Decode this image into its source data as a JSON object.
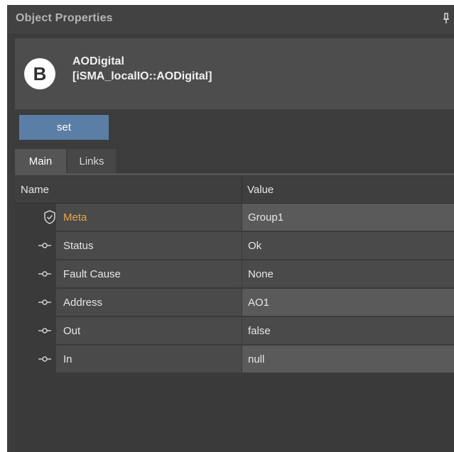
{
  "panel": {
    "title": "Object Properties",
    "colors": {
      "background": "#3c3c3c",
      "button": "#5b7ea6",
      "meta_label": "#e8a64a"
    }
  },
  "object": {
    "badge_letter": "B",
    "name": "AODigital",
    "type": "[iSMA_localIO::AODigital]"
  },
  "actions": {
    "set_label": "set"
  },
  "tabs": [
    {
      "label": "Main",
      "active": true
    },
    {
      "label": "Links",
      "active": false
    }
  ],
  "grid": {
    "columns": [
      "Name",
      "Value"
    ],
    "rows": [
      {
        "name": "Meta",
        "value": "Group1",
        "icon": "shield-icon"
      },
      {
        "name": "Status",
        "value": "Ok",
        "icon": "slot-link-icon"
      },
      {
        "name": "Fault Cause",
        "value": "None",
        "icon": "slot-link-icon"
      },
      {
        "name": "Address",
        "value": "AO1",
        "icon": "slot-link-icon"
      },
      {
        "name": "Out",
        "value": "false",
        "icon": "slot-link-icon"
      },
      {
        "name": "In",
        "value": "null",
        "icon": "slot-link-icon"
      }
    ]
  }
}
